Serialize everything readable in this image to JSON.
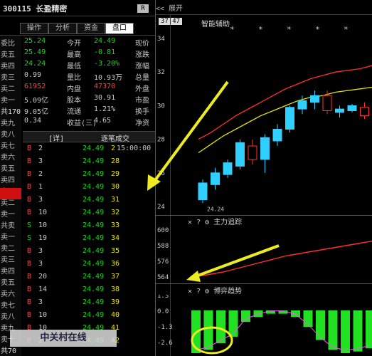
{
  "header": {
    "title": "300115 长盈精密",
    "badge": "R"
  },
  "tabs": [
    {
      "label": "盘口"
    },
    {
      "label": "资金"
    },
    {
      "label": "分析"
    },
    {
      "label": "操作"
    }
  ],
  "left_rail": [
    "委比",
    "卖五",
    "卖四",
    "卖三",
    "卖二",
    "卖一",
    "共170",
    "卖九",
    "卖八",
    "卖七",
    "卖六",
    "卖五",
    "卖四",
    "卖三",
    "卖二",
    "卖一",
    "共卖",
    "卖一",
    "卖二",
    "卖三",
    "卖四",
    "卖五",
    "卖六",
    "卖七",
    "卖八",
    "卖九",
    "卖十",
    "共70"
  ],
  "quote": {
    "rows": [
      {
        "l1": "现价",
        "v1": "24.49",
        "l2": "今开",
        "v2": "25.24"
      },
      {
        "l1": "涨跌",
        "v1": "-0.81",
        "l2": "最高",
        "v2": "25.49"
      },
      {
        "l1": "涨幅",
        "v1": "-3.20%",
        "l2": "最低",
        "v2": "24.24"
      },
      {
        "l1": "总量",
        "v1": "10.93万",
        "l2": "量比",
        "v2": "0.99"
      },
      {
        "l1": "外盘",
        "v1": "47370",
        "l2": "内盘",
        "v2": "61952"
      },
      {
        "l1": "市盈",
        "v1": "30.91",
        "l2": "股本",
        "v2": "5.09亿"
      },
      {
        "l1": "换手",
        "v1": "1.21%",
        "l2": "流通",
        "v2": "9.05亿"
      },
      {
        "l1": "净资",
        "v1": "4.65",
        "l2": "收益(三)",
        "v2": "0.34"
      }
    ],
    "commitment_side_label": "委比"
  },
  "trades_header": {
    "label": "逐笔成交",
    "tag": "[详]"
  },
  "trades": [
    {
      "time": "15:00:00",
      "price": "24.49",
      "vol": "2",
      "flag": "B"
    },
    {
      "time": "",
      "price": "24.49",
      "vol": "28",
      "flag": "B"
    },
    {
      "time": "",
      "price": "24.49",
      "vol": "29",
      "flag": "B"
    },
    {
      "time": "",
      "price": "24.49",
      "vol": "30",
      "flag": "B"
    },
    {
      "time": "",
      "price": "24.49",
      "vol": "31",
      "flag": "B"
    },
    {
      "time": "",
      "price": "24.49",
      "vol": "32",
      "flag": "B"
    },
    {
      "time": "",
      "price": "24.49",
      "vol": "33",
      "flag": "S"
    },
    {
      "time": "",
      "price": "24.49",
      "vol": "34",
      "flag": "S"
    },
    {
      "time": "",
      "price": "24.49",
      "vol": "35",
      "flag": "B"
    },
    {
      "time": "",
      "price": "24.49",
      "vol": "36",
      "flag": "B"
    },
    {
      "time": "",
      "price": "24.49",
      "vol": "37",
      "flag": "B"
    },
    {
      "time": "",
      "price": "24.49",
      "vol": "38",
      "flag": "B"
    },
    {
      "time": "",
      "price": "24.49",
      "vol": "39",
      "flag": "B"
    },
    {
      "time": "",
      "price": "24.49",
      "vol": "40",
      "flag": "B"
    },
    {
      "time": "",
      "price": "24.49",
      "vol": "41",
      "flag": "B"
    },
    {
      "time": "",
      "price": "24.49",
      "vol": "42",
      "flag": "B"
    }
  ],
  "trade_vols_col": [
    "2",
    "3",
    "2",
    "1",
    "3",
    "10",
    "10",
    "19",
    "3",
    "3",
    "20",
    "14",
    "3",
    "10",
    "10",
    "2"
  ],
  "chart_header": {
    "collapse": "<< 展开",
    "label": "智能辅助",
    "stars": [
      "*",
      "*",
      "*",
      "*",
      "*",
      "*"
    ],
    "badge": "37.47"
  },
  "price_axis": [
    "34",
    "32",
    "30",
    "28",
    "26",
    "24"
  ],
  "low_label": "24.24",
  "panel2": {
    "title": "主力追踪",
    "axis": [
      "600",
      "588",
      "576",
      "564"
    ]
  },
  "panel3": {
    "title": "博弈趋势",
    "axis": [
      "1.3",
      "0.0",
      "-1.3",
      "-2.6"
    ]
  },
  "watermark": "中关村在线",
  "colors": {
    "up": "#ff3030",
    "down": "#16d916",
    "accent": "#ecec20",
    "ma1": "#ff3030",
    "ma2": "#e6e600"
  },
  "chart_data": {
    "type": "candlestick",
    "candles": [
      {
        "o": 24.4,
        "c": 25.4,
        "h": 25.6,
        "l": 24.2,
        "dir": "up"
      },
      {
        "o": 25.3,
        "c": 26.0,
        "h": 26.3,
        "l": 25.0,
        "dir": "up"
      },
      {
        "o": 25.9,
        "c": 26.6,
        "h": 26.8,
        "l": 25.7,
        "dir": "up"
      },
      {
        "o": 26.4,
        "c": 27.8,
        "h": 28.0,
        "l": 26.2,
        "dir": "up"
      },
      {
        "o": 27.6,
        "c": 26.8,
        "h": 28.0,
        "l": 26.5,
        "dir": "down"
      },
      {
        "o": 26.8,
        "c": 28.1,
        "h": 28.3,
        "l": 26.0,
        "dir": "up"
      },
      {
        "o": 27.9,
        "c": 28.6,
        "h": 28.9,
        "l": 27.6,
        "dir": "up"
      },
      {
        "o": 28.6,
        "c": 29.9,
        "h": 30.0,
        "l": 28.4,
        "dir": "up"
      },
      {
        "o": 29.8,
        "c": 30.3,
        "h": 30.6,
        "l": 29.5,
        "dir": "up"
      },
      {
        "o": 30.2,
        "c": 30.6,
        "h": 30.9,
        "l": 29.8,
        "dir": "up"
      },
      {
        "o": 30.6,
        "c": 29.7,
        "h": 30.9,
        "l": 29.5,
        "dir": "down"
      },
      {
        "o": 29.6,
        "c": 29.8,
        "h": 30.0,
        "l": 29.3,
        "dir": "up"
      },
      {
        "o": 29.7,
        "c": 30.0,
        "h": 30.1,
        "l": 29.6,
        "dir": "up"
      },
      {
        "o": 29.9,
        "c": 29.4,
        "h": 30.2,
        "l": 29.2,
        "dir": "down"
      },
      {
        "o": 30.0,
        "c": 30.5,
        "h": 30.6,
        "l": 29.8,
        "dir": "up"
      }
    ],
    "ma_red": [
      28.0,
      28.4,
      28.9,
      29.4,
      29.8,
      30.2,
      30.6,
      31.0,
      31.3,
      31.6,
      31.8,
      32.0,
      32.1,
      32.2,
      32.4
    ],
    "ma_yellow": [
      27.2,
      27.7,
      28.2,
      28.6,
      29.0,
      29.4,
      29.7,
      30.0,
      30.3,
      30.5,
      30.6,
      30.8,
      30.9,
      31.0,
      31.1
    ],
    "ylim": [
      24,
      34
    ],
    "panel2_red": [
      556,
      558,
      560,
      563,
      566,
      569,
      572,
      575,
      577,
      579,
      581,
      583,
      585,
      587,
      589
    ],
    "panel3_bars": [
      -2.6,
      -2.4,
      -2.0,
      -1.6,
      -0.7,
      -0.4,
      -0.2,
      -0.2,
      -0.4,
      -1.0,
      -1.8,
      -2.4,
      -2.6,
      -2.5,
      -2.3
    ]
  }
}
